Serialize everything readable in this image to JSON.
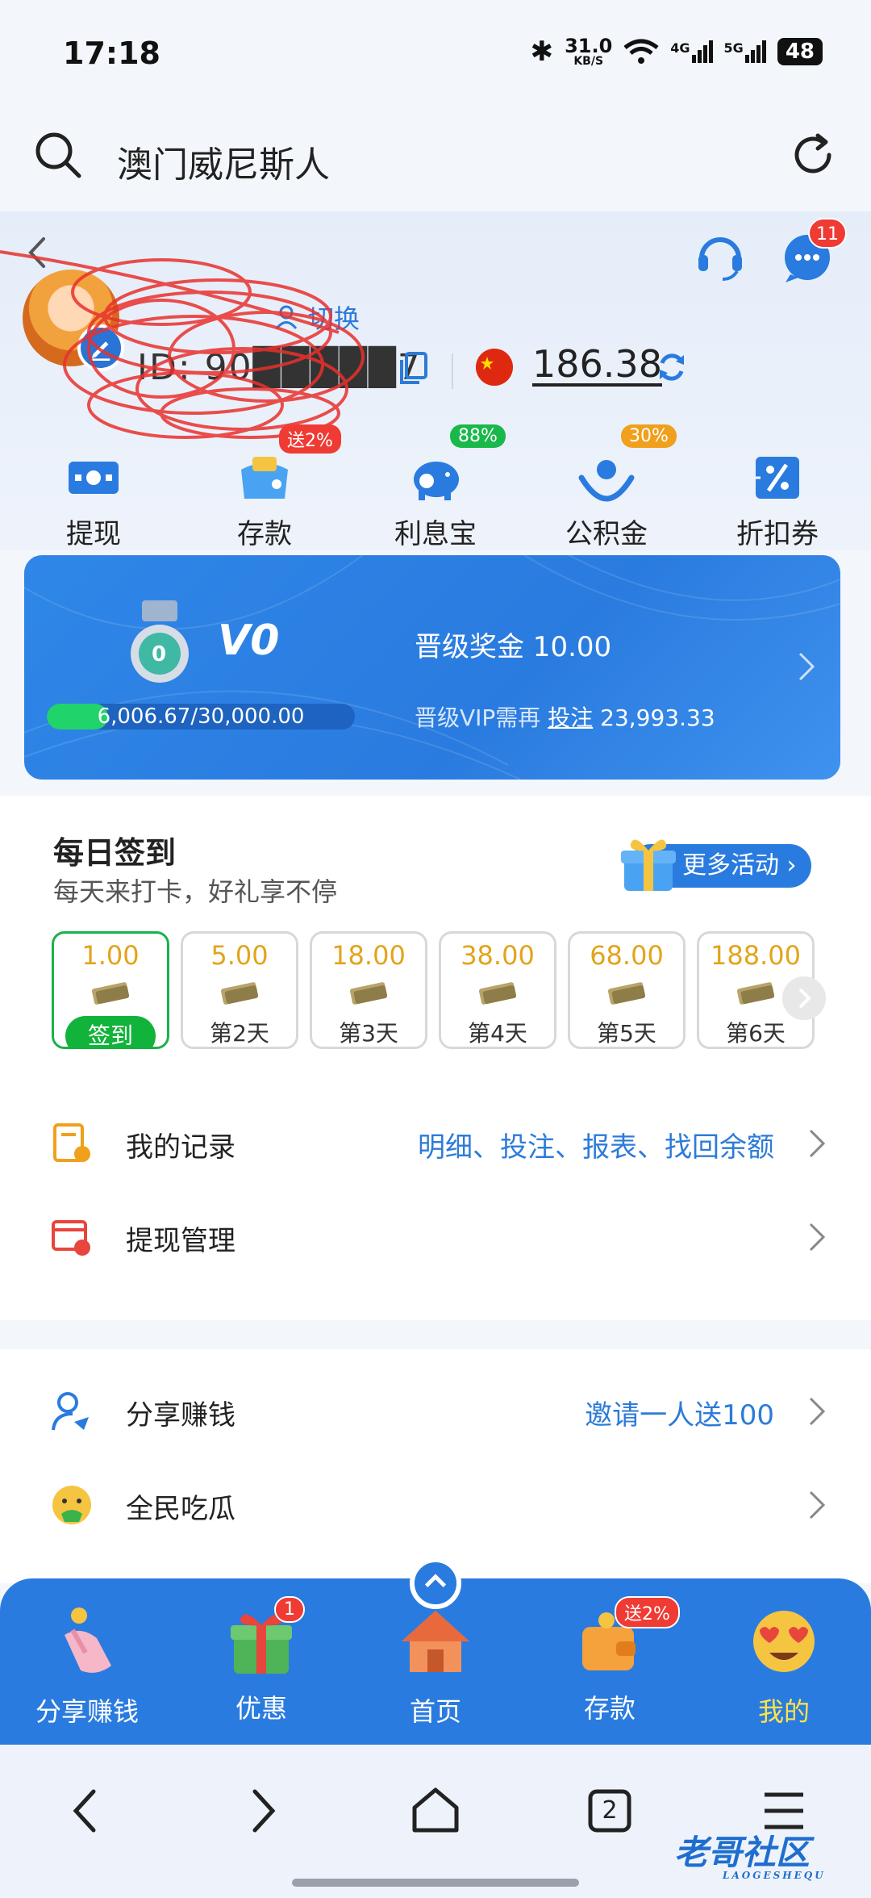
{
  "status_bar": {
    "time": "17:18",
    "net_speed": "31.0",
    "net_unit": "KB/S",
    "sig1": "4G",
    "sig2": "5G",
    "battery": "48"
  },
  "browser": {
    "search_text": "澳门威尼斯人"
  },
  "account": {
    "switch_label": "切换",
    "user_id": "ID: 90█████7",
    "balance": "186.38",
    "message_count": "11"
  },
  "quick_actions": [
    {
      "label": "提现",
      "icon": "withdraw-icon",
      "badge": ""
    },
    {
      "label": "存款",
      "icon": "deposit-wallet-icon",
      "badge": "送2%",
      "badge_color": "#ef3b34"
    },
    {
      "label": "利息宝",
      "icon": "piggy-bank-icon",
      "badge": "88%",
      "badge_color": "#18b94a"
    },
    {
      "label": "公积金",
      "icon": "fund-hands-icon",
      "badge": "30%",
      "badge_color": "#f0a01c"
    },
    {
      "label": "折扣券",
      "icon": "coupon-icon",
      "badge": ""
    }
  ],
  "vip": {
    "medal_level": "0",
    "level": "V0",
    "progress_text": "6,006.67/30,000.00",
    "progress_fraction": 0.2,
    "bonus": "晋级奖金 10.00",
    "need_prefix": "晋级VIP需再",
    "need_link": "投注",
    "need_value": "23,993.33"
  },
  "checkin": {
    "title": "每日签到",
    "subtitle": "每天来打卡，好礼享不停",
    "more_label": "更多活动",
    "days": [
      {
        "amount": "1.00",
        "label": "签到",
        "active": true
      },
      {
        "amount": "5.00",
        "label": "第2天"
      },
      {
        "amount": "18.00",
        "label": "第3天"
      },
      {
        "amount": "38.00",
        "label": "第4天"
      },
      {
        "amount": "68.00",
        "label": "第5天"
      },
      {
        "amount": "188.00",
        "label": "第6天"
      }
    ]
  },
  "menu": {
    "records_label": "我的记录",
    "records_extra": "明细、投注、报表、找回余额",
    "withdraw_label": "提现管理",
    "share_label": "分享赚钱",
    "share_extra": "邀请一人送100",
    "gossip_label": "全民吃瓜"
  },
  "tabs": [
    {
      "label": "分享赚钱",
      "icon": "share-hand-icon"
    },
    {
      "label": "优惠",
      "icon": "gift-box-icon",
      "badge": "1"
    },
    {
      "label": "首页",
      "icon": "house-icon"
    },
    {
      "label": "存款",
      "icon": "wallet-icon",
      "badge": "送2%"
    },
    {
      "label": "我的",
      "icon": "heart-eyes-emoji-icon",
      "active": true
    }
  ],
  "nav": {
    "tab_count": "2"
  },
  "watermark": {
    "text": "老哥社区",
    "sub": "LAOGESHEQU"
  }
}
